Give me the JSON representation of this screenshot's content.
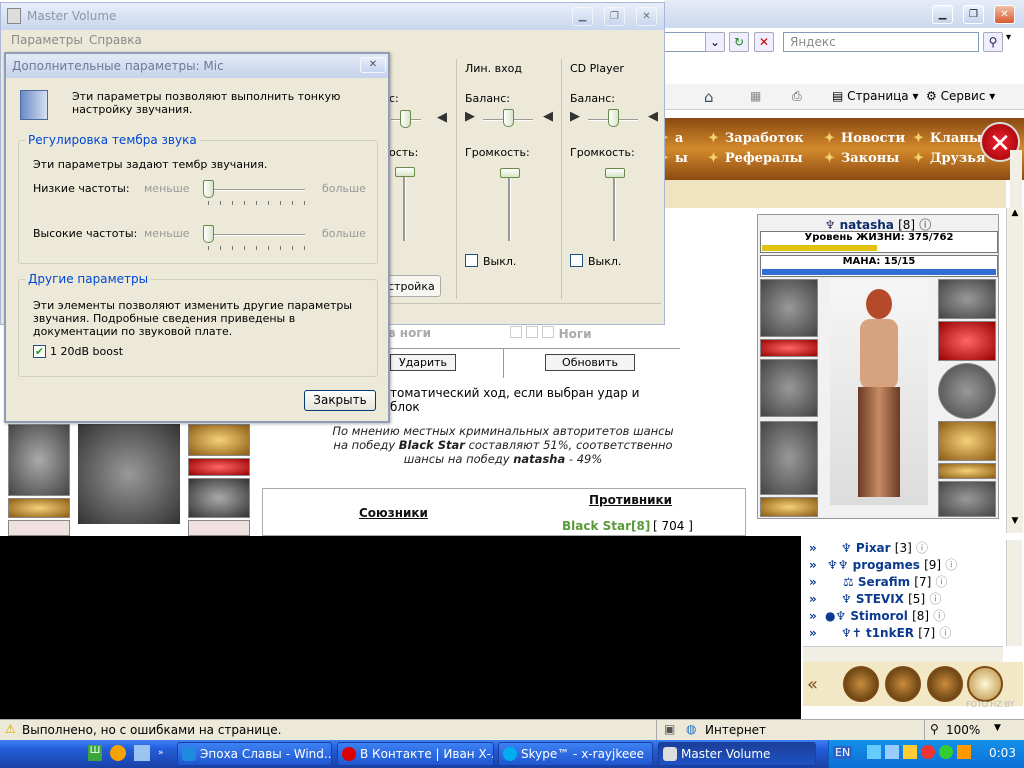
{
  "ie": {
    "search_placeholder": "Яндекс",
    "command_bar": {
      "page": "Страница",
      "service": "Сервис"
    },
    "status_text": "Выполнено, но с ошибками на странице.",
    "zone": "Интернет",
    "zoom": "100%"
  },
  "game": {
    "nav_items": [
      "Заработок",
      "Новости",
      "Кланы",
      "Рефералы",
      "Законы",
      "Друзья"
    ],
    "nav_partial": [
      "а",
      "ы"
    ],
    "character": {
      "name": "natasha",
      "level": "[8]",
      "hp_label": "Уровень ЖИЗНИ: 375/762",
      "hp_fraction": 0.49,
      "mana_label": "МАНА: 15/15"
    },
    "battle": {
      "legs_label": "в ноги",
      "legs_label_right": "Ноги",
      "hit_button": "Ударить",
      "refresh_button": "Обновить",
      "auto_move": "томатический ход, если выбран удар и блок",
      "chances_line1": "По мнению местных криминальных авторитетов шансы",
      "chances_line2_pre": "на победу ",
      "chances_line2_name": "Black Star",
      "chances_line2_post": " составляют 51%, соответственно",
      "chances_line3_pre": "шансы на победу ",
      "chances_line3_name": "natasha",
      "chances_line3_post": " - 49%",
      "allies": "Союзники",
      "enemies": "Противники",
      "enemy_name": "Black Star[8]",
      "enemy_hp": "[ 704 ]"
    },
    "players": [
      {
        "name": "Pixar",
        "level": "[3]"
      },
      {
        "name": "progames",
        "level": "[9]"
      },
      {
        "name": "Serafim",
        "level": "[7]"
      },
      {
        "name": "STEVIX",
        "level": "[5]"
      },
      {
        "name": "Stimorol",
        "level": "[8]"
      },
      {
        "name": "t1nkER",
        "level": "[7]"
      }
    ],
    "watermark": "FOTO.HZ.BY"
  },
  "master_volume": {
    "title": "Master Volume",
    "menu": [
      "Параметры",
      "Справка"
    ],
    "columns": [
      {
        "name": "Лин. вход",
        "balance": "Баланс:",
        "volume": "Громкость:",
        "mute": "Выкл."
      },
      {
        "name": "CD Player",
        "balance": "Баланс:",
        "volume": "Громкость:",
        "mute": "Выкл."
      }
    ],
    "partial_balance": "с:",
    "partial_volume": "ость:",
    "partial_button": "стройка"
  },
  "advanced": {
    "title": "Дополнительные параметры: Mic",
    "description": "Эти параметры позволяют выполнить тонкую настройку звучания.",
    "tone_group": "Регулировка тембра звука",
    "tone_text": "Эти параметры задают тембр звучания.",
    "bass_label": "Низкие частоты:",
    "treble_label": "Высокие частоты:",
    "less": "меньше",
    "more": "больше",
    "other_group": "Другие параметры",
    "other_text": "Эти элементы позволяют изменить другие параметры звучания. Подробные сведения приведены в документации по звуковой плате.",
    "boost_label": "1  20dB boost",
    "boost_checked": true,
    "close_button": "Закрыть"
  },
  "taskbar": {
    "tasks": [
      "Эпоха Славы - Wind...",
      "В Контакте | Иван Х-...",
      "Skype™ - x-rayjkeee",
      "Master Volume"
    ],
    "lang": "EN",
    "clock": "0:03"
  }
}
